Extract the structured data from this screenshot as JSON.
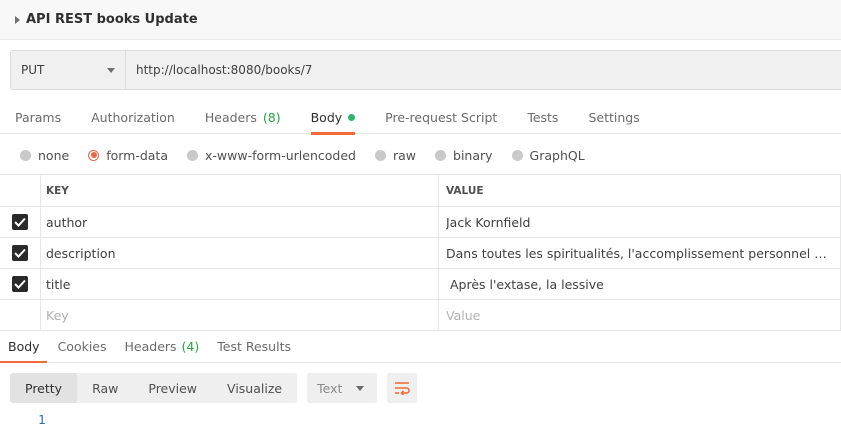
{
  "title": "API REST books Update",
  "request": {
    "method": "PUT",
    "url": "http://localhost:8080/books/7"
  },
  "tabs": [
    {
      "label": "Params"
    },
    {
      "label": "Authorization"
    },
    {
      "label": "Headers",
      "count": "(8)"
    },
    {
      "label": "Body"
    },
    {
      "label": "Pre-request Script"
    },
    {
      "label": "Tests"
    },
    {
      "label": "Settings"
    }
  ],
  "body_types": [
    {
      "label": "none"
    },
    {
      "label": "form-data"
    },
    {
      "label": "x-www-form-urlencoded"
    },
    {
      "label": "raw"
    },
    {
      "label": "binary"
    },
    {
      "label": "GraphQL"
    }
  ],
  "selected_body_type": "form-data",
  "table": {
    "key_header": "KEY",
    "value_header": "VALUE",
    "rows": [
      {
        "key": "author",
        "value": "Jack Kornfield",
        "checked": true
      },
      {
        "key": "description",
        "value": "Dans toutes les spiritualités, l'accomplissement personnel passe pa...",
        "checked": true
      },
      {
        "key": "title",
        "value": " Après l'extase, la lessive",
        "checked": true
      }
    ],
    "key_placeholder": "Key",
    "value_placeholder": "Value"
  },
  "response_tabs": [
    {
      "label": "Body"
    },
    {
      "label": "Cookies"
    },
    {
      "label": "Headers",
      "count": "(4)"
    },
    {
      "label": "Test Results"
    }
  ],
  "view_modes": [
    "Pretty",
    "Raw",
    "Preview",
    "Visualize"
  ],
  "active_view_mode": "Pretty",
  "format": "Text",
  "line_number": "1",
  "colors": {
    "accent": "#f26b3a",
    "count_green": "#2f9e44",
    "dot_green": "#2fb36d",
    "line_number_blue": "#2c6fb3"
  }
}
